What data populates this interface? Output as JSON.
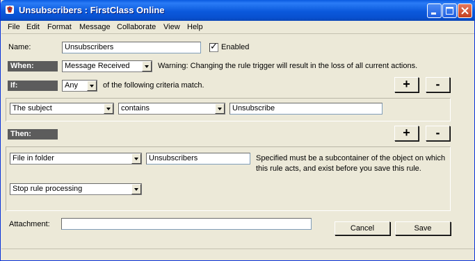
{
  "window": {
    "title": "Unsubscribers : FirstClass Online",
    "app_icon": "firstclass-app-icon"
  },
  "menu": [
    "File",
    "Edit",
    "Format",
    "Message",
    "Collaborate",
    "View",
    "Help"
  ],
  "name_row": {
    "label": "Name:",
    "value": "Unsubscribers",
    "enabled_label": "Enabled",
    "enabled_checked": true
  },
  "when": {
    "header": "When:",
    "trigger": "Message Received",
    "warning": "Warning:  Changing the rule trigger will result in the loss of all current actions."
  },
  "if": {
    "header": "If:",
    "match": "Any",
    "match_suffix": "of the following criteria match.",
    "add": "+",
    "remove": "-"
  },
  "criteria": {
    "field": "The subject",
    "operator": "contains",
    "value": "Unsubscribe"
  },
  "then": {
    "header": "Then:",
    "add": "+",
    "remove": "-"
  },
  "actions": {
    "action1": "File in folder",
    "folder": "Unsubscribers",
    "note_line1": "Specified must be a subcontainer of the object on which",
    "note_line2": "this rule acts, and  exist before you save this rule.",
    "action2": "Stop rule processing"
  },
  "attachment": {
    "label": "Attachment:",
    "value": ""
  },
  "buttons": {
    "cancel": "Cancel",
    "save": "Save"
  },
  "colors": {
    "titlebar": "#0a5ae0",
    "header_bg": "#5c5c5c",
    "window_bg": "#ece9d8"
  }
}
